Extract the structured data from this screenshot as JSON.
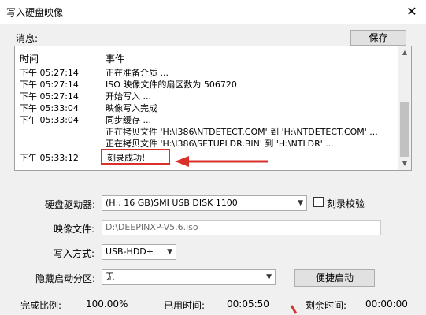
{
  "window": {
    "title": "写入硬盘映像",
    "close_glyph": "✕"
  },
  "messages": {
    "label": "消息:",
    "save_label": "保存",
    "columns": [
      "时间",
      "事件"
    ],
    "rows": [
      {
        "time": "下午 05:27:14",
        "event": "正在准备介质 ..."
      },
      {
        "time": "下午 05:27:14",
        "event": "ISO 映像文件的扇区数为 506720"
      },
      {
        "time": "下午 05:27:14",
        "event": "开始写入 ..."
      },
      {
        "time": "下午 05:33:04",
        "event": "映像写入完成"
      },
      {
        "time": "下午 05:33:04",
        "event": "同步缓存 ..."
      },
      {
        "time": "",
        "event": "正在拷贝文件 'H:\\I386\\NTDETECT.COM' 到 'H:\\NTDETECT.COM' ..."
      },
      {
        "time": "",
        "event": "正在拷贝文件 'H:\\I386\\SETUPLDR.BIN' 到 'H:\\NTLDR' ..."
      }
    ],
    "success_row": {
      "time": "下午 05:33:12",
      "event": "刻录成功!"
    }
  },
  "form": {
    "drive_label": "硬盘驱动器:",
    "drive_value": "(H:, 16 GB)SMI     USB DISK          1100",
    "verify_label": "刻录校验",
    "image_label": "映像文件:",
    "image_value": "D:\\DEEPINXP-V5.6.iso",
    "write_mode_label": "写入方式:",
    "write_mode_value": "USB-HDD+",
    "hidden_partition_label": "隐藏启动分区:",
    "hidden_partition_value": "无",
    "quick_boot_label": "便捷启动"
  },
  "status": {
    "progress_label": "完成比例:",
    "progress_value": "100.00%",
    "elapsed_label": "已用时间:",
    "elapsed_value": "00:05:50",
    "remaining_label": "剩余时间:",
    "remaining_value": "00:00:00"
  },
  "colors": {
    "annotation": "#d9302a"
  }
}
